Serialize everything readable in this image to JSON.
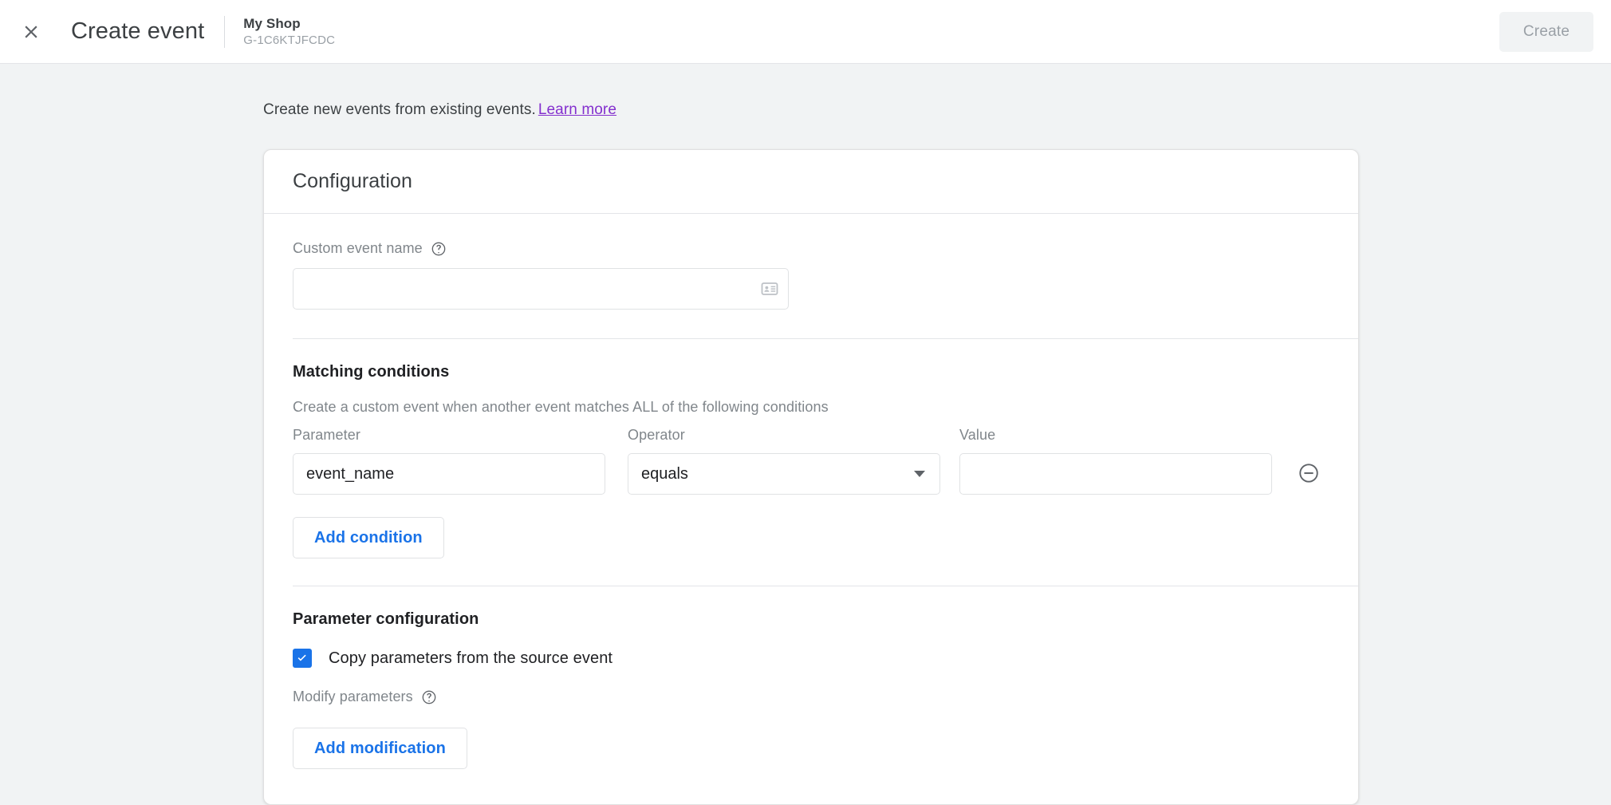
{
  "header": {
    "close_icon": "close-icon",
    "title": "Create event",
    "property_name": "My Shop",
    "property_id": "G-1C6KTJFCDC",
    "create_label": "Create"
  },
  "intro": {
    "text": "Create new events from existing events.",
    "link_label": "Learn more"
  },
  "card": {
    "title": "Configuration",
    "custom_event_name": {
      "label": "Custom event name",
      "help_icon": "help-circle-icon",
      "value": "",
      "placeholder": "",
      "trailing_icon": "contact-card-icon"
    },
    "matching_conditions": {
      "title": "Matching conditions",
      "description": "Create a custom event when another event matches ALL of the following conditions",
      "columns": {
        "parameter": "Parameter",
        "operator": "Operator",
        "value": "Value"
      },
      "rows": [
        {
          "parameter": "event_name",
          "operator": "equals",
          "value": "",
          "remove_icon": "minus-circle-icon"
        }
      ],
      "add_condition_label": "Add condition"
    },
    "parameter_configuration": {
      "title": "Parameter configuration",
      "copy_parameters_label": "Copy parameters from the source event",
      "copy_parameters_checked": true,
      "modify_parameters_label": "Modify parameters",
      "modify_help_icon": "help-circle-icon",
      "add_modification_label": "Add modification"
    }
  },
  "colors": {
    "accent_blue": "#1a73e8",
    "link_purple": "#8430ce",
    "page_background": "#f1f3f4",
    "card_background": "#ffffff",
    "muted_text": "#80868b"
  }
}
